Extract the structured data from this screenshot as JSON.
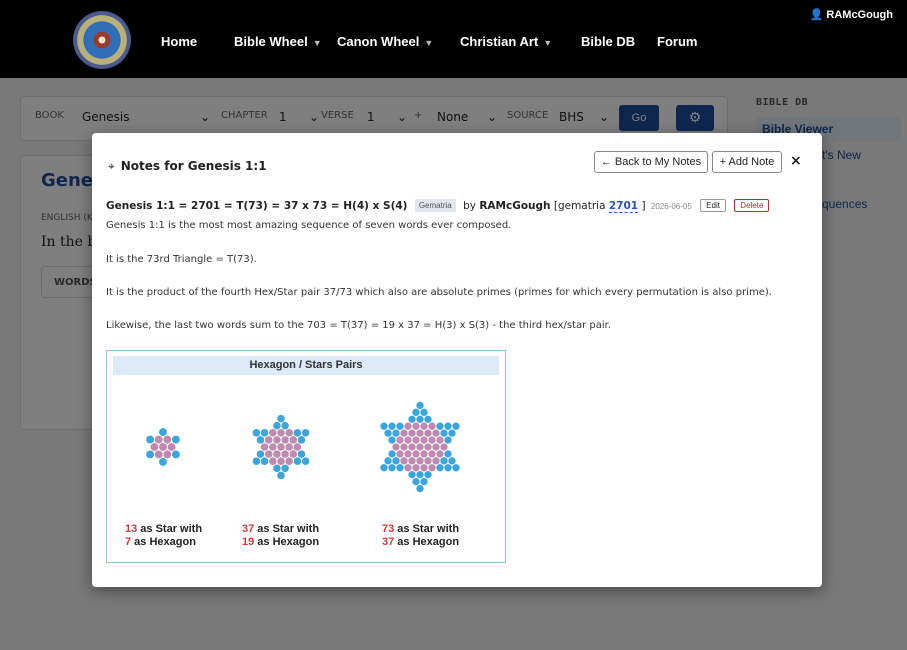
{
  "nav": {
    "items": [
      {
        "label": "Home",
        "dropdown": false
      },
      {
        "label": "Bible Wheel",
        "dropdown": true
      },
      {
        "label": "Canon Wheel",
        "dropdown": true
      },
      {
        "label": "Christian Art",
        "dropdown": true
      },
      {
        "label": "Bible DB",
        "dropdown": false
      },
      {
        "label": "Forum",
        "dropdown": false
      }
    ],
    "user": "RAMcGough"
  },
  "toolbar": {
    "book_label": "BOOK",
    "book_value": "Genesis",
    "chapter_label": "CHAPTER",
    "chapter_value": "1",
    "verse_label": "VERSE",
    "verse_value": "1",
    "plus": "+",
    "range_value": "None",
    "source_label": "SOURCE",
    "source_value": "BHS",
    "go_label": "Go"
  },
  "page": {
    "title_partial": "Gene",
    "english_label": "ENGLISH (K",
    "verse_partial": "In the be",
    "words_tab": "WORDS"
  },
  "sidebar": {
    "heading": "BIBLE DB",
    "items": [
      "Bible Viewer",
      "t's New",
      "quences"
    ]
  },
  "modal": {
    "title": "Notes for Genesis 1:1",
    "back_button": "← Back to My Notes",
    "add_button": "+ Add Note",
    "close": "×",
    "note": {
      "heading": "Genesis 1:1 = 2701 = T(73) = 37 x 73 = H(4) x S(4)",
      "tag": "Gematria",
      "by": "by",
      "author": "RAMcGough",
      "gematria_prefix": "[gematria",
      "gematria_value": "2701",
      "gematria_suffix": "]",
      "date": "2026-06-05",
      "edit": "Edit",
      "delete": "Delete",
      "paragraphs": [
        "Genesis 1:1 is the most most amazing sequence of seven words ever composed.",
        "It is the 73rd Triangle = T(73).",
        "It is the product of the fourth Hex/Star pair 37/73 which also are absolute primes (primes for which every permutation is also prime).",
        "Likewise, the last two words sum to the 703 = T(37) = 19 x 37 = H(3) x S(3) - the third hex/star pair."
      ]
    },
    "figure": {
      "title": "Hexagon / Stars Pairs",
      "colors": {
        "star": "#3aa6dc",
        "hexagon": "#c08ab0"
      },
      "captions": [
        {
          "star_num": "13",
          "star_text": " as Star with",
          "hex_num": "7",
          "hex_text": " as Hexagon"
        },
        {
          "star_num": "37",
          "star_text": " as Star with",
          "hex_num": "19",
          "hex_text": " as Hexagon"
        },
        {
          "star_num": "73",
          "star_text": " as Star with",
          "hex_num": "37",
          "hex_text": " as Hexagon"
        }
      ]
    }
  }
}
